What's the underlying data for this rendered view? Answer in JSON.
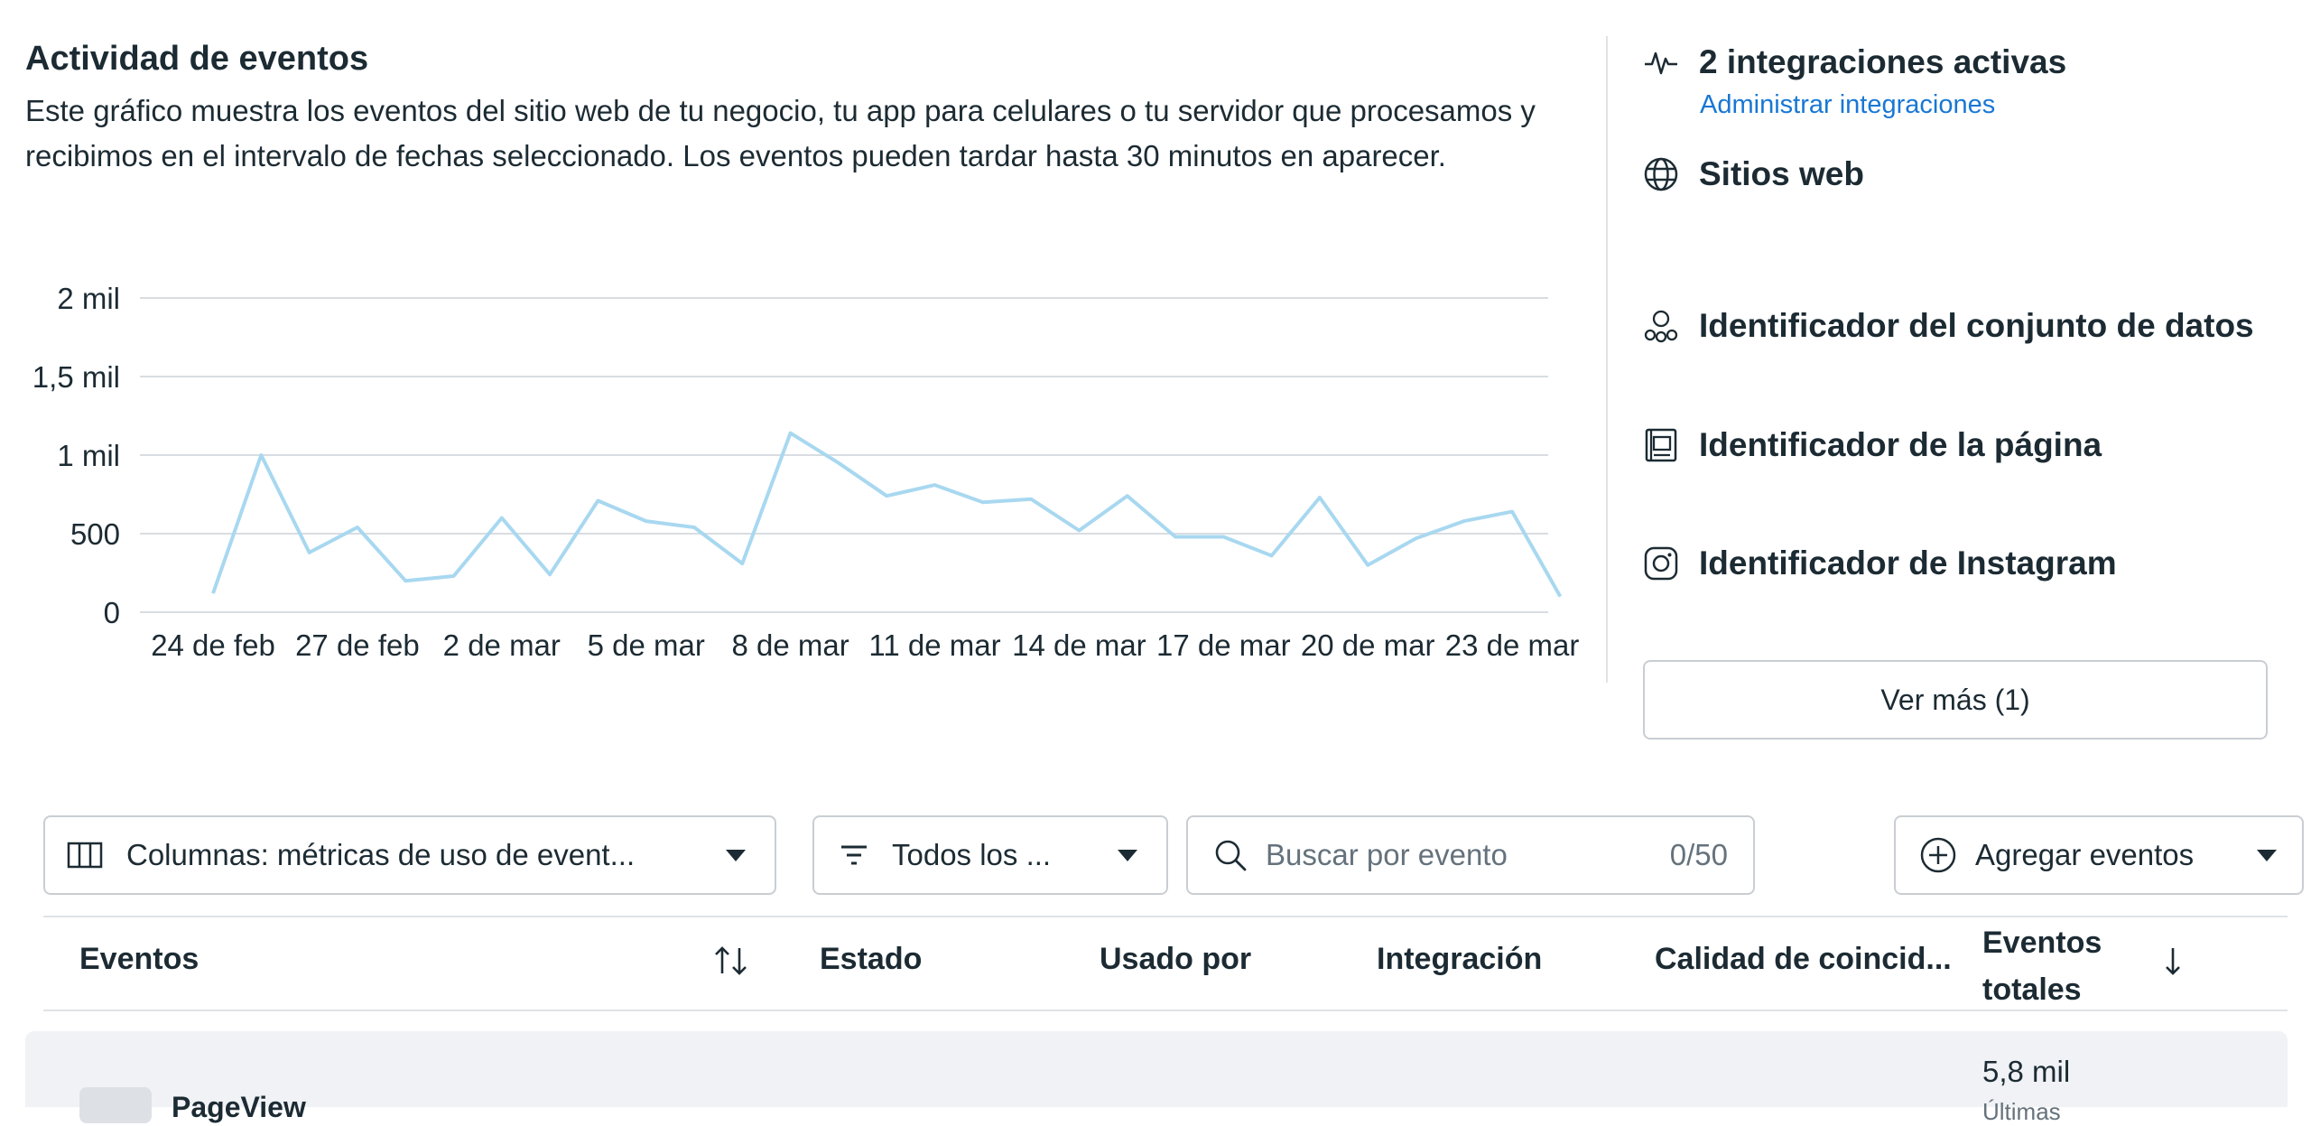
{
  "activity": {
    "title": "Actividad de eventos",
    "description": "Este gráfico muestra los eventos del sitio web de tu negocio, tu app para celulares o tu servidor que procesamos y recibimos en el intervalo de fechas seleccionado. Los eventos pueden tardar hasta 30 minutos en aparecer."
  },
  "chart_data": {
    "type": "line",
    "x_tick_labels": [
      "24 de feb",
      "27 de feb",
      "2 de mar",
      "5 de mar",
      "8 de mar",
      "11 de mar",
      "14 de mar",
      "17 de mar",
      "20 de mar",
      "23 de mar"
    ],
    "y_tick_labels": [
      "2 mil",
      "1,5 mil",
      "1 mil",
      "500",
      "0"
    ],
    "ylim": [
      0,
      2000
    ],
    "grid": true,
    "series": [
      {
        "color": "#a8d8f0",
        "values": [
          120,
          1000,
          380,
          540,
          200,
          230,
          600,
          240,
          710,
          580,
          540,
          310,
          1140,
          950,
          740,
          810,
          700,
          720,
          520,
          740,
          480,
          480,
          360,
          730,
          300,
          470,
          580,
          640,
          100
        ]
      }
    ]
  },
  "sidebar": {
    "integrations": "2 integraciones activas",
    "manage_link": "Administrar integraciones",
    "websites": "Sitios web",
    "dataset_id": "Identificador del conjunto de datos",
    "page_id": "Identificador de la página",
    "instagram_id": "Identificador de Instagram",
    "see_more": "Ver más (1)"
  },
  "toolbar": {
    "columns": "Columnas: métricas de uso de event...",
    "filter": "Todos los ...",
    "search_placeholder": "Buscar por evento",
    "search_count": "0/50",
    "add_events": "Agregar eventos"
  },
  "table": {
    "headers": {
      "events": "Eventos",
      "status": "Estado",
      "used_by": "Usado por",
      "integration": "Integración",
      "match_quality": "Calidad de coincid...",
      "total_events_line1": "Eventos",
      "total_events_line2": "totales"
    },
    "rows": [
      {
        "name": "PageView",
        "total": "5,8 mil",
        "sub": "Últimas"
      }
    ]
  }
}
